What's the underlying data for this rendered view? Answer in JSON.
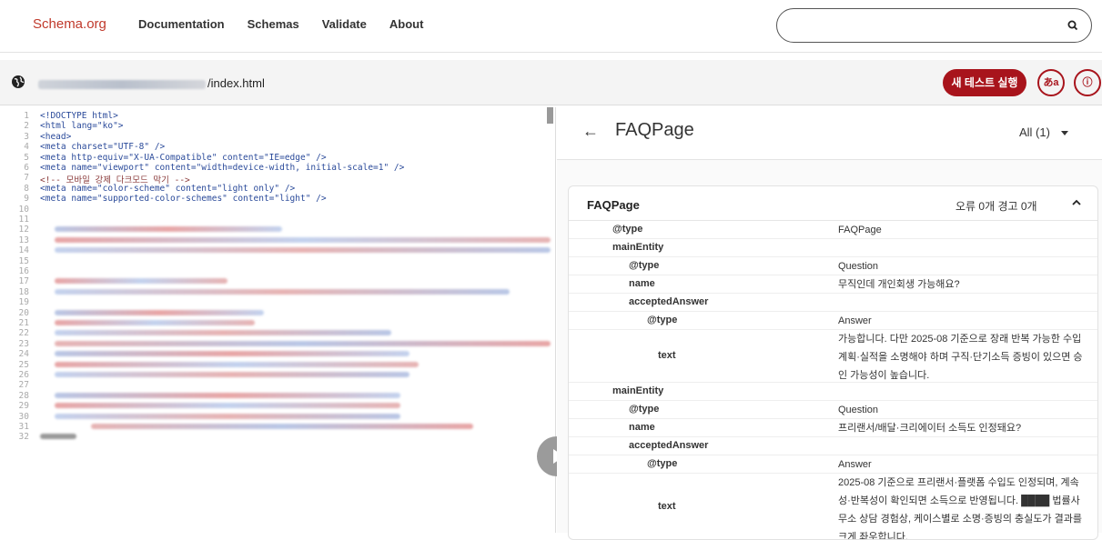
{
  "nav": {
    "logo": "Schema.org",
    "links": [
      "Documentation",
      "Schemas",
      "Validate",
      "About"
    ],
    "search_placeholder": ""
  },
  "urlbar": {
    "url_suffix": "/index.html",
    "new_test_label": "새 테스트 실행",
    "lang_label": "あa",
    "info_label": "ⓘ"
  },
  "code": {
    "lines": [
      {
        "n": "1",
        "t": "<!DOCTYPE html>"
      },
      {
        "n": "2",
        "t": "<html lang=\"ko\">"
      },
      {
        "n": "3",
        "t": "  <head>"
      },
      {
        "n": "4",
        "t": "    <meta charset=\"UTF-8\" />"
      },
      {
        "n": "5",
        "t": "    <meta http-equiv=\"X-UA-Compatible\" content=\"IE=edge\" />"
      },
      {
        "n": "6",
        "t": "    <meta name=\"viewport\" content=\"width=device-width, initial-scale=1\" />"
      },
      {
        "n": "7",
        "t": "    <!-- 모바일 강제 다크모드 막기 -->"
      },
      {
        "n": "8",
        "t": "    <meta name=\"color-scheme\" content=\"light only\" />"
      },
      {
        "n": "9",
        "t": "    <meta name=\"supported-color-schemes\" content=\"light\" />"
      },
      {
        "n": "10",
        "t": ""
      },
      {
        "n": "11",
        "t": ""
      },
      {
        "n": "12",
        "t": ""
      },
      {
        "n": "13",
        "t": ""
      },
      {
        "n": "14",
        "t": ""
      },
      {
        "n": "15",
        "t": ""
      },
      {
        "n": "16",
        "t": ""
      },
      {
        "n": "17",
        "t": ""
      },
      {
        "n": "18",
        "t": ""
      },
      {
        "n": "19",
        "t": ""
      },
      {
        "n": "20",
        "t": ""
      },
      {
        "n": "21",
        "t": ""
      },
      {
        "n": "22",
        "t": ""
      },
      {
        "n": "23",
        "t": ""
      },
      {
        "n": "24",
        "t": ""
      },
      {
        "n": "25",
        "t": ""
      },
      {
        "n": "26",
        "t": ""
      },
      {
        "n": "27",
        "t": ""
      },
      {
        "n": "28",
        "t": ""
      },
      {
        "n": "29",
        "t": ""
      },
      {
        "n": "30",
        "t": ""
      },
      {
        "n": "31",
        "t": ""
      },
      {
        "n": "32",
        "t": ""
      }
    ]
  },
  "result": {
    "back_icon": "←",
    "title": "FAQPage",
    "filter_label": "All (1)",
    "card_title": "FAQPage",
    "counts": "오류 0개   경고 0개",
    "rows": [
      {
        "k": "@type",
        "v": "FAQPage"
      },
      {
        "k": "mainEntity",
        "v": ""
      },
      {
        "k": "@type",
        "v": "Question"
      },
      {
        "k": "name",
        "v": "무직인데 개인회생 가능해요?"
      },
      {
        "k": "acceptedAnswer",
        "v": ""
      },
      {
        "k": "@type",
        "v": "Answer"
      },
      {
        "k": "text",
        "v": "가능합니다. 다만 2025-08 기준으로 장래 반복 가능한 수입 계획·실적을 소명해야 하며 구직·단기소득 증빙이 있으면 승인 가능성이 높습니다."
      },
      {
        "k": "mainEntity",
        "v": ""
      },
      {
        "k": "@type",
        "v": "Question"
      },
      {
        "k": "name",
        "v": "프리랜서/배달·크리에이터 소득도 인정돼요?"
      },
      {
        "k": "acceptedAnswer",
        "v": ""
      },
      {
        "k": "@type",
        "v": "Answer"
      },
      {
        "k": "text",
        "v": "2025-08 기준으로 프리랜서·플랫폼 수입도 인정되며, 계속성·반복성이 확인되면 소득으로 반영됩니다. ████ 법률사무소 상담 경험상, 케이스별로 소명·증빙의 충실도가 결과를 크게 좌우합니다."
      }
    ]
  }
}
